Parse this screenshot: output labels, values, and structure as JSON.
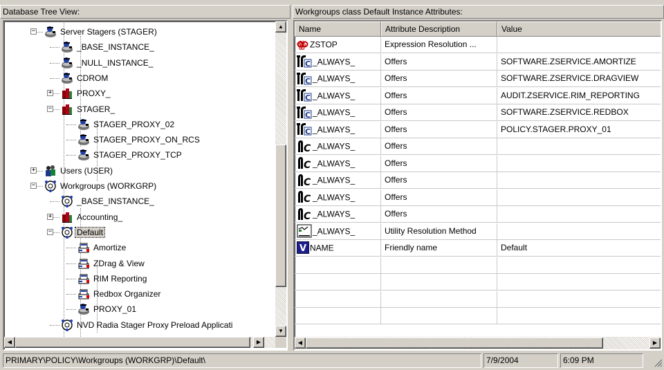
{
  "left_pane": {
    "header": "Database Tree View:"
  },
  "right_pane": {
    "header": "Workgroups class Default Instance Attributes:"
  },
  "tree": [
    {
      "label": "Server Stagers (STAGER)",
      "icon": "server-stager-icon",
      "expander": "-"
    },
    {
      "label": "_BASE_INSTANCE_",
      "icon": "stager-instance-icon"
    },
    {
      "label": "_NULL_INSTANCE_",
      "icon": "stager-instance-icon"
    },
    {
      "label": "CDROM",
      "icon": "stager-instance-icon"
    },
    {
      "label": "PROXY_",
      "icon": "class-books-icon",
      "expander": "+"
    },
    {
      "label": "STAGER_",
      "icon": "class-books-icon",
      "expander": "-"
    },
    {
      "label": "STAGER_PROXY_02",
      "icon": "stager-instance-icon"
    },
    {
      "label": "STAGER_PROXY_ON_RCS",
      "icon": "stager-instance-icon"
    },
    {
      "label": "STAGER_PROXY_TCP",
      "icon": "stager-instance-icon"
    },
    {
      "label": "Users (USER)",
      "icon": "users-icon",
      "expander": "+"
    },
    {
      "label": "Workgroups (WORKGRP)",
      "icon": "workgroup-icon",
      "expander": "-"
    },
    {
      "label": "_BASE_INSTANCE_",
      "icon": "workgroup-icon"
    },
    {
      "label": "Accounting_",
      "icon": "class-books-icon",
      "expander": "+"
    },
    {
      "label": "Default",
      "icon": "workgroup-icon",
      "expander": "-",
      "selected": true
    },
    {
      "label": "Amortize",
      "icon": "package-icon"
    },
    {
      "label": "ZDrag & View",
      "icon": "package-icon"
    },
    {
      "label": "RIM Reporting",
      "icon": "package-icon"
    },
    {
      "label": "Redbox Organizer",
      "icon": "package-icon"
    },
    {
      "label": "PROXY_01",
      "icon": "stager-instance-icon"
    },
    {
      "label": "NVD Radia Stager Proxy Preload  Applicati",
      "icon": "workgroup-icon"
    }
  ],
  "table": {
    "columns": [
      "Name",
      "Attribute Description",
      "Value"
    ],
    "rows": [
      {
        "icon": "expression-icon",
        "name": "ZSTOP",
        "desc": "Expression Resolution ...",
        "value": ""
      },
      {
        "icon": "class-connection-icon",
        "name": "_ALWAYS_",
        "desc": "Offers",
        "value": "SOFTWARE.ZSERVICE.AMORTIZE"
      },
      {
        "icon": "class-connection-icon",
        "name": "_ALWAYS_",
        "desc": "Offers",
        "value": "SOFTWARE.ZSERVICE.DRAGVIEW"
      },
      {
        "icon": "class-connection-icon",
        "name": "_ALWAYS_",
        "desc": "Offers",
        "value": "AUDIT.ZSERVICE.RIM_REPORTING"
      },
      {
        "icon": "class-connection-icon",
        "name": "_ALWAYS_",
        "desc": "Offers",
        "value": "SOFTWARE.ZSERVICE.REDBOX"
      },
      {
        "icon": "class-connection-icon",
        "name": "_ALWAYS_",
        "desc": "Offers",
        "value": "POLICY.STAGER.PROXY_01"
      },
      {
        "icon": "empty-connection-icon",
        "name": "_ALWAYS_",
        "desc": "Offers",
        "value": ""
      },
      {
        "icon": "empty-connection-icon",
        "name": "_ALWAYS_",
        "desc": "Offers",
        "value": ""
      },
      {
        "icon": "empty-connection-icon",
        "name": "_ALWAYS_",
        "desc": "Offers",
        "value": ""
      },
      {
        "icon": "empty-connection-icon",
        "name": "_ALWAYS_",
        "desc": "Offers",
        "value": ""
      },
      {
        "icon": "empty-connection-icon",
        "name": "_ALWAYS_",
        "desc": "Offers",
        "value": ""
      },
      {
        "icon": "method-icon",
        "name": "_ALWAYS_",
        "desc": "Utility Resolution Method",
        "value": ""
      },
      {
        "icon": "variable-icon",
        "name": "NAME",
        "desc": "Friendly name",
        "value": "Default",
        "badge": "V"
      }
    ]
  },
  "status": {
    "path": "PRIMARY\\POLICY\\Workgroups (WORKGRP)\\Default\\",
    "date": "7/9/2004",
    "time": "6:09 PM"
  }
}
